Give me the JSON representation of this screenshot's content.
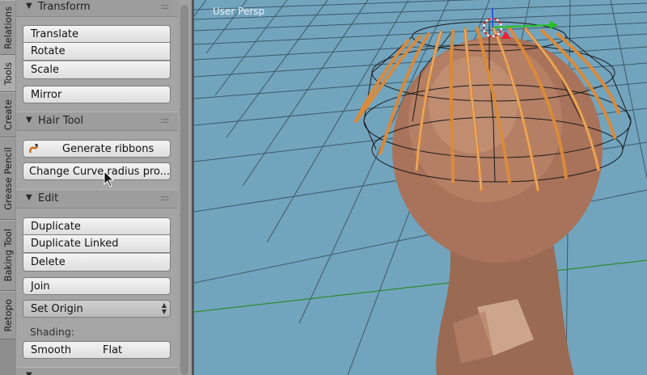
{
  "tabs": [
    "Relations",
    "Tools",
    "Create",
    "Grease Pencil",
    "Baking Tool",
    "Retopo"
  ],
  "transform": {
    "title": "Transform",
    "translate": "Translate",
    "rotate": "Rotate",
    "scale": "Scale",
    "mirror": "Mirror"
  },
  "hair_tool": {
    "title": "Hair Tool",
    "generate_ribbons": "Generate ribbons",
    "change_curve_radius": "Change Curve radius pro..."
  },
  "edit": {
    "title": "Edit",
    "duplicate": "Duplicate",
    "duplicate_linked": "Duplicate Linked",
    "delete": "Delete",
    "join": "Join",
    "set_origin": "Set Origin",
    "shading_label": "Shading:",
    "smooth": "Smooth",
    "flat": "Flat"
  },
  "viewport": {
    "label": "User Persp"
  },
  "colors": {
    "viewport_bg": "#72a4be",
    "panel_bg": "#a5a5a5",
    "grid_line": "#2a3a44",
    "x_axis": "#2e8a2e",
    "mesh_skin": "#b07a60",
    "curve_orange": "#d98a3a"
  }
}
